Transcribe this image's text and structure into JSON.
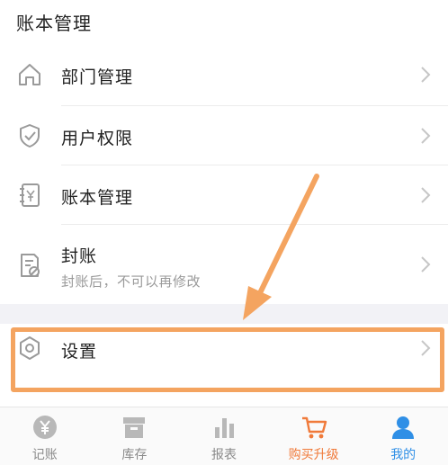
{
  "section": {
    "title": "账本管理"
  },
  "menu": {
    "items": [
      {
        "label": "部门管理",
        "icon": "home-icon"
      },
      {
        "label": "用户权限",
        "icon": "shield-check-icon"
      },
      {
        "label": "账本管理",
        "icon": "ledger-book-icon"
      },
      {
        "label": "封账",
        "sublabel": "封账后，不可以再修改",
        "icon": "closed-ledger-icon"
      }
    ],
    "settings": {
      "label": "设置",
      "icon": "hexagon-settings-icon"
    }
  },
  "tabbar": {
    "items": [
      {
        "label": "记账",
        "icon": "yen-coin-icon",
        "active": false
      },
      {
        "label": "库存",
        "icon": "inventory-box-icon",
        "active": false
      },
      {
        "label": "报表",
        "icon": "bar-chart-icon",
        "active": false
      },
      {
        "label": "购买升级",
        "icon": "shopping-cart-icon",
        "active": false,
        "accent": true
      },
      {
        "label": "我的",
        "icon": "user-icon",
        "active": true
      }
    ]
  },
  "colors": {
    "highlight": "#f4a460",
    "active_tab": "#2f8fe6",
    "accent_tab": "#f07a3a",
    "inactive_icon": "#b8b8b8",
    "menu_icon": "#9a9a9a"
  }
}
